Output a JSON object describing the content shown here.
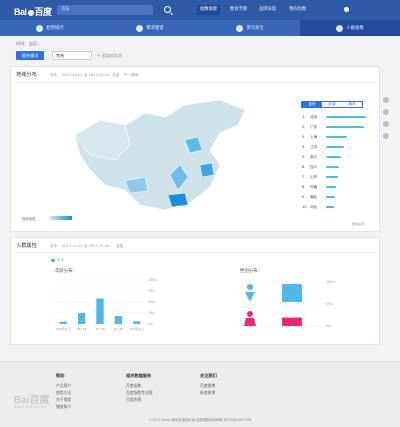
{
  "header": {
    "logo_text": "Bai",
    "logo_text2": "百度",
    "search_value": "京东",
    "nav": [
      "指数探索",
      "数说专题",
      "品牌表现",
      "我的指数"
    ],
    "user": "▲"
  },
  "subnav": [
    "趋势研究",
    "需求图谱",
    "资讯关注",
    "人群画像"
  ],
  "breadcrumb": "时间：当月；",
  "toolbar": {
    "compare_label": "搜关键词",
    "keyword": "京东",
    "add_compare": "+ 添加对比词"
  },
  "region": {
    "title": "地域分布",
    "meta": [
      "京东",
      "2017-10-01 至 2017-10-31",
      "全国",
      "PC+移动"
    ],
    "tabs": [
      "省份",
      "区域",
      "城市"
    ],
    "ranking": [
      {
        "rank": "1.",
        "name": "北京",
        "value": 100
      },
      {
        "rank": "2.",
        "name": "广东",
        "value": 96
      },
      {
        "rank": "3.",
        "name": "上海",
        "value": 52
      },
      {
        "rank": "4.",
        "name": "江苏",
        "value": 44
      },
      {
        "rank": "5.",
        "name": "浙江",
        "value": 38
      },
      {
        "rank": "6.",
        "name": "四川",
        "value": 33
      },
      {
        "rank": "7.",
        "name": "山东",
        "value": 30
      },
      {
        "rank": "8.",
        "name": "河南",
        "value": 26
      },
      {
        "rank": "9.",
        "name": "湖北",
        "value": 22
      },
      {
        "rank": "10.",
        "name": "河北",
        "value": 20
      }
    ],
    "legend_label": "搜索指数",
    "source_note": "数据来源"
  },
  "population": {
    "title": "人群属性",
    "meta": [
      "京东",
      "2017-11-01 至 2017-11-30",
      "全国"
    ],
    "legend": "京东",
    "age_title": "年龄分布：",
    "gender_title": "性别分布：",
    "chart_data": {
      "type": "bar",
      "categories": [
        "19岁及以下",
        "20~29",
        "30~39",
        "40~49",
        "50岁及以上"
      ],
      "values": [
        5,
        25,
        58,
        18,
        6
      ],
      "ylim": [
        0,
        100
      ],
      "yticks": [
        "100%",
        "75%",
        "50%",
        "25%",
        "0%"
      ]
    },
    "gender_data": {
      "type": "bar",
      "categories": [
        "男",
        "女"
      ],
      "values": [
        68,
        32
      ],
      "yticks": [
        "100%",
        "50%",
        "0%"
      ],
      "colors": {
        "male": "#4fb8e9",
        "female": "#e6287a"
      }
    }
  },
  "footer": {
    "cols": [
      {
        "heading": "帮助",
        "items": [
          "产品简介",
          "使用方法",
          "关于搜索",
          "播放简介"
        ]
      },
      {
        "heading": "相关数据服务",
        "items": [
          "百度指数",
          "百度指数专业版",
          "百度热榜"
        ]
      },
      {
        "heading": "关注我们",
        "items": [
          "百度微博",
          "新浪微博"
        ]
      }
    ],
    "copyright": "©2017 Baidu  使用百度前必读  百度指数使用声明  京ICP证030173号"
  },
  "colors": {
    "brand": "#2f5aa8",
    "accent": "#2f72e0",
    "bar": "#4fb8e9"
  }
}
